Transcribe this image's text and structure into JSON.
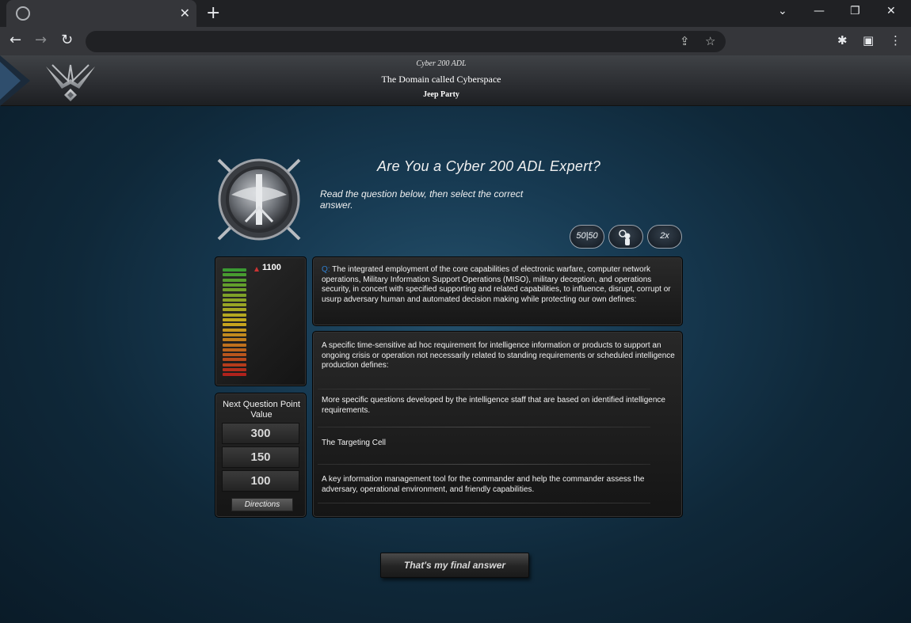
{
  "browser": {
    "tab_close": "✕",
    "new_tab": "+",
    "window_controls": [
      "⌄",
      "—",
      "❐",
      "✕"
    ],
    "nav": {
      "back": "←",
      "forward": "→",
      "reload": "↻"
    },
    "omnibox_icons": {
      "share": "⇪",
      "bookmark": "☆"
    },
    "toolbar_icons": {
      "extensions": "✱",
      "side_panel": "▣",
      "menu": "⋮"
    }
  },
  "header": {
    "course": "Cyber 200 ADL",
    "title": "The Domain called Cyberspace",
    "game": "Jeep Party"
  },
  "game": {
    "title": "Are You a Cyber 200 ADL Expert?",
    "instructions": "Read the question below, then select the correct answer.",
    "lifelines": [
      {
        "name": "fifty-fifty",
        "label": "50|50"
      },
      {
        "name": "ask-expert",
        "label": ""
      },
      {
        "name": "double-points",
        "label": "2x"
      }
    ],
    "score": "1100",
    "next_question_label": "Next Question Point Value",
    "point_values": [
      "300",
      "150",
      "100"
    ],
    "directions_label": "Directions",
    "question_prefix": "Q:",
    "question": "The integrated employment of the core capabilities of electronic warfare, computer network operations, Military Information Support Operations (MISO), military deception, and operations security, in concert with specified supporting and related capabilities, to influence, disrupt, corrupt or usurp adversary human and automated decision making while protecting our own defines:",
    "answers": [
      "A specific time-sensitive ad hoc requirement for intelligence information or products to support an ongoing crisis or operation not necessarily related to standing requirements or scheduled intelligence production defines:",
      "More specific questions developed by the intelligence staff that are based on identified intelligence requirements.",
      "The Targeting Cell",
      "A key information management tool for the commander and help the commander assess the adversary, operational environment, and friendly capabilities."
    ],
    "final_answer_label": "That's my final answer"
  },
  "colors": {
    "question_prefix": "#2f7fcf",
    "meter_green": "#3a9a32",
    "meter_red": "#b0221c",
    "background_blue": "#173a52"
  }
}
